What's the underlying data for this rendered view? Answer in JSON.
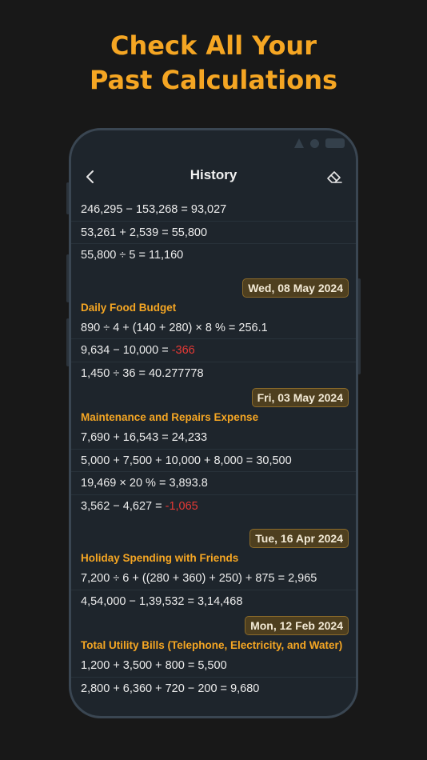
{
  "headline": {
    "line1": "Check All Your",
    "line2": "Past Calculations"
  },
  "app": {
    "title": "History",
    "back_icon": "chevron-left-icon",
    "clear_icon": "eraser-icon"
  },
  "groups": [
    {
      "date": "",
      "label": "",
      "rows": [
        {
          "expr": "246,295 − 153,268 = ",
          "result": "93,027",
          "negative": false
        },
        {
          "expr": "53,261 + 2,539 = ",
          "result": "55,800",
          "negative": false
        },
        {
          "expr": "55,800 ÷ 5 = ",
          "result": "11,160",
          "negative": false
        }
      ]
    },
    {
      "date": "Wed, 08 May 2024",
      "label": "Daily Food Budget",
      "rows": [
        {
          "expr": "890 ÷ 4 + (140 + 280) × 8 % = ",
          "result": "256.1",
          "negative": false
        },
        {
          "expr": "9,634 − 10,000 = ",
          "result": "-366",
          "negative": true
        },
        {
          "expr": "1,450 ÷ 36 = ",
          "result": "40.277778",
          "negative": false
        }
      ]
    },
    {
      "date": "Fri, 03 May 2024",
      "label": "Maintenance and Repairs Expense",
      "rows": [
        {
          "expr": "7,690 + 16,543 = ",
          "result": "24,233",
          "negative": false
        },
        {
          "expr": "5,000 + 7,500 + 10,000 + 8,000 = ",
          "result": "30,500",
          "negative": false
        },
        {
          "expr": "19,469 × 20 % = ",
          "result": "3,893.8",
          "negative": false
        },
        {
          "expr": "3,562 − 4,627 = ",
          "result": "-1,065",
          "negative": true
        }
      ]
    },
    {
      "date": "Tue, 16 Apr 2024",
      "label": "Holiday Spending with Friends",
      "rows": [
        {
          "expr": "7,200 ÷ 6 + ((280 + 360) + 250) + 875 = ",
          "result": "2,965",
          "negative": false
        },
        {
          "expr": "4,54,000 − 1,39,532 = ",
          "result": "3,14,468",
          "negative": false
        }
      ]
    },
    {
      "date": "Mon, 12 Feb 2024",
      "label": "Total Utility Bills (Telephone, Electricity, and Water)",
      "rows": [
        {
          "expr": "1,200 + 3,500 + 800 = ",
          "result": "5,500",
          "negative": false
        },
        {
          "expr": "2,800 + 6,360 + 720 − 200 = ",
          "result": "9,680",
          "negative": false
        }
      ]
    }
  ],
  "colors": {
    "accent": "#f5a623",
    "negative": "#e53935",
    "background": "#181818",
    "screen": "#1e252c"
  }
}
